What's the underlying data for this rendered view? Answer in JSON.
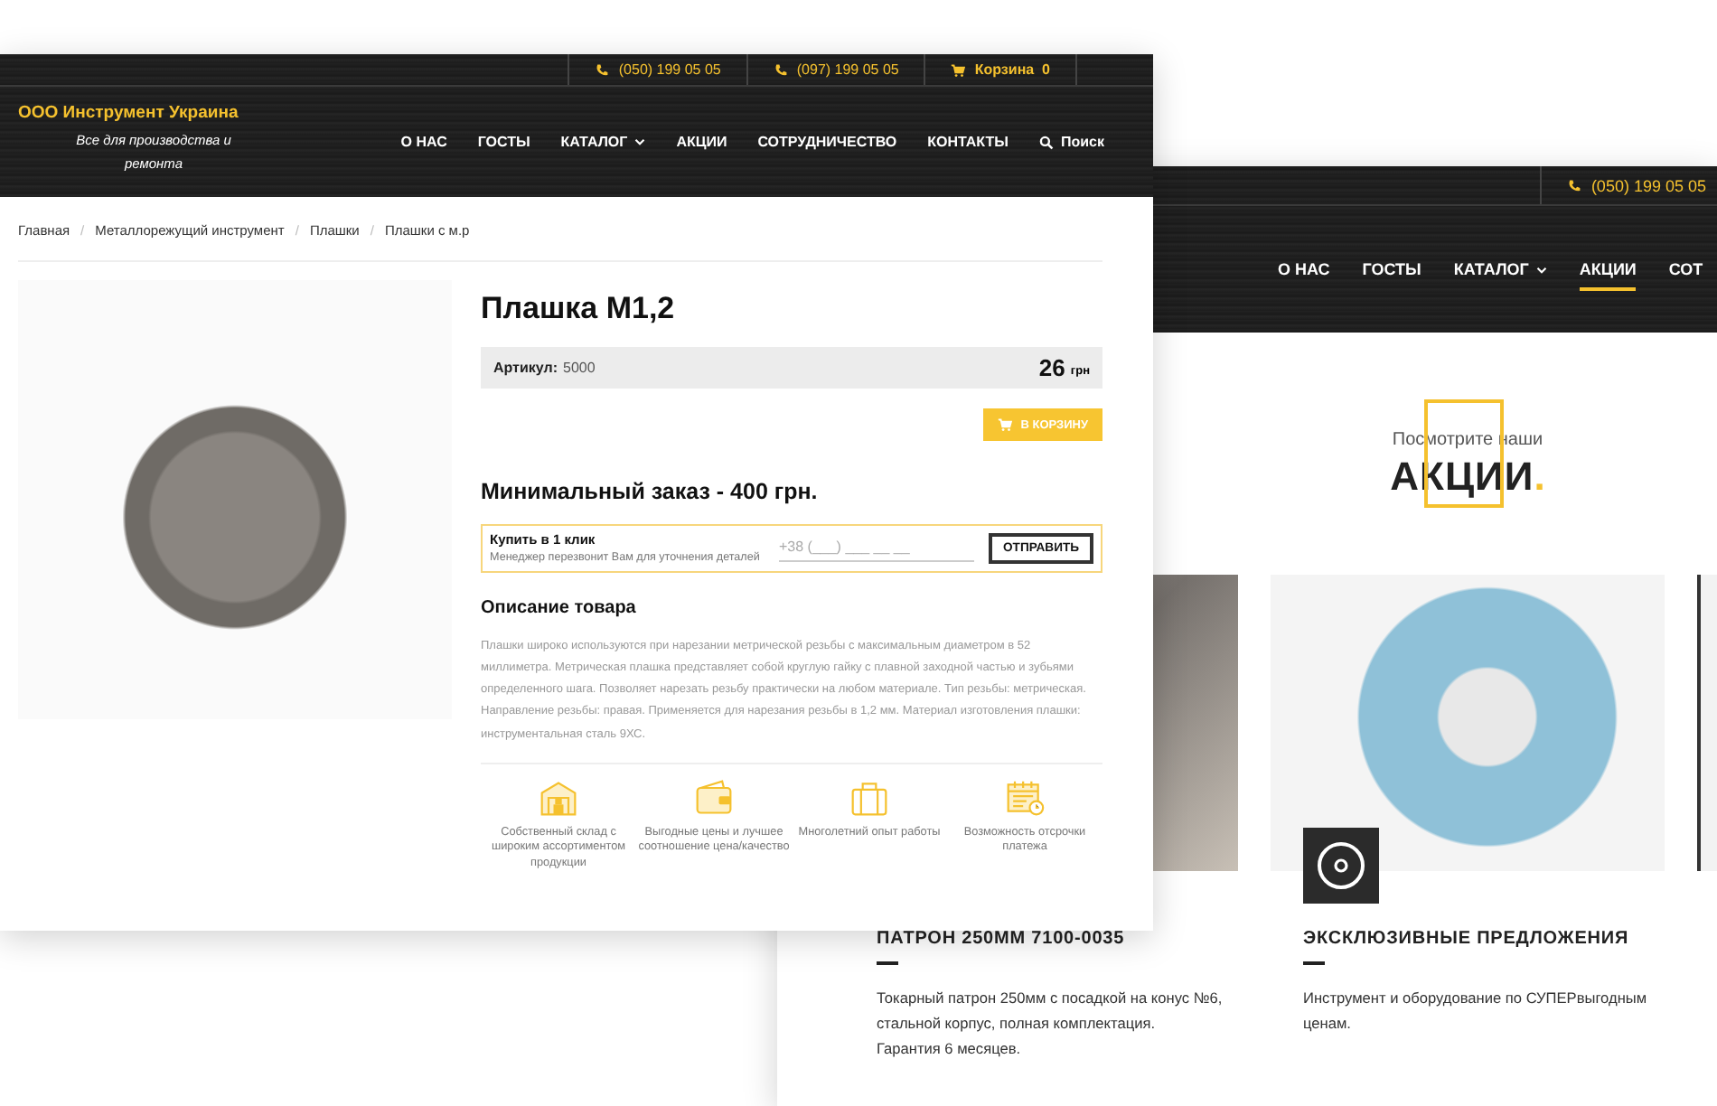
{
  "front_page": {
    "top_bar": {
      "phones": [
        "(050) 199 05 05",
        "(097) 199 05 05"
      ],
      "cart_label": "Корзина",
      "cart_count": "0"
    },
    "logo": {
      "title": "ООО Инструмент Украина",
      "tagline": "Все для производства и ремонта"
    },
    "nav": [
      {
        "label": "О НАС",
        "kind": "link"
      },
      {
        "label": "ГОСТЫ",
        "kind": "link"
      },
      {
        "label": "КАТАЛОГ",
        "kind": "dropdown"
      },
      {
        "label": "АКЦИИ",
        "kind": "link"
      },
      {
        "label": "СОТРУДНИЧЕСТВО",
        "kind": "link"
      },
      {
        "label": "КОНТАКТЫ",
        "kind": "link"
      },
      {
        "label": "Поиск",
        "kind": "search"
      }
    ],
    "breadcrumb_separator": "/",
    "breadcrumbs": [
      "Главная",
      "Металлорежущий инструмент",
      "Плашки",
      "Плашки с м.р"
    ],
    "product": {
      "title": "Плашка М1,2",
      "sku_label": "Артикул:",
      "sku": "5000",
      "price": "26",
      "currency": "грн",
      "cart_button": "В КОРЗИНУ",
      "min_order": "Минимальный заказ - 400 грн."
    },
    "one_click": {
      "title": "Купить в 1 клик",
      "hint": "Менеджер перезвонит Вам для уточнения деталей",
      "placeholder": "+38 (___) ___ __ __",
      "button": "ОТПРАВИТЬ"
    },
    "description": {
      "heading": "Описание товара",
      "text": "Плашки широко используются при нарезании метрической резьбы с максимальным диаметром в 52 миллиметра. Метрическая плашка представляет собой круглую гайку с плавной заходной частью и зубьями определенного шага. Позволяет нарезать резьбу практически на любом материале. Тип резьбы: метрическая. Направление резьбы: правая. Применяется для нарезания резьбы в 1,2 мм. Материал изготовления плашки: инструментальная сталь 9ХС."
    },
    "features": [
      {
        "kind": "warehouse",
        "text": "Собственный склад с широким ассортиментом продукции"
      },
      {
        "kind": "wallet",
        "text": "Выгодные цены и лучшее соотношение цена/качество"
      },
      {
        "kind": "suitcase",
        "text": "Многолетний опыт работы"
      },
      {
        "kind": "calendar",
        "text": "Возможность отсрочки платежа"
      }
    ]
  },
  "back_page": {
    "top_bar": {
      "phone": "(050) 199 05 05"
    },
    "nav": [
      {
        "label": "О НАС",
        "kind": "link",
        "selected": false
      },
      {
        "label": "ГОСТЫ",
        "kind": "link",
        "selected": false
      },
      {
        "label": "КАТАЛОГ",
        "kind": "dropdown",
        "selected": false
      },
      {
        "label": "АКЦИИ",
        "kind": "link",
        "selected": true
      },
      {
        "label": "СОТ",
        "kind": "link",
        "selected": false
      }
    ],
    "hero": {
      "subtitle": "Посмотрите наши",
      "title": "АКЦИИ",
      "title_mark": "."
    },
    "cards": [
      {
        "title": "ПАТРОН 250ММ 7100-0035",
        "lines": [
          "Токарный патрон 250мм с посадкой на конус №6, стальной корпус, полная комплектация.",
          "Гарантия 6 месяцев."
        ]
      },
      {
        "title": "ЭКСКЛЮЗИВНЫЕ ПРЕДЛОЖЕНИЯ",
        "lines": [
          "Инструмент и оборудование по СУПЕРвыгодным ценам."
        ]
      }
    ]
  }
}
